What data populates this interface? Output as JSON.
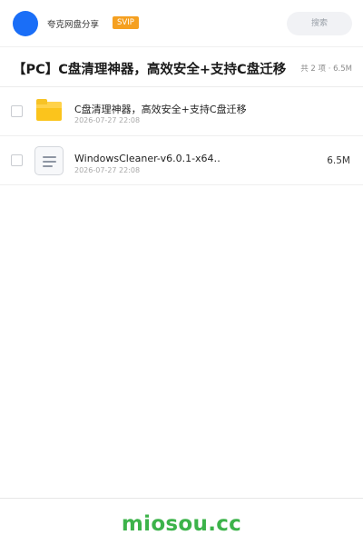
{
  "header": {
    "share_name": "夸克网盘分享",
    "badge": "SVIP",
    "search_placeholder": "搜索"
  },
  "title_bar": {
    "title": "【PC】C盘清理神器，高效安全+支持C盘迁移",
    "meta": "共 2 项 · 6.5M"
  },
  "files": [
    {
      "name": "C盘清理神器，高效安全+支持C盘迁移",
      "date": "2026-07-27 22:08",
      "size": "",
      "icon": "folder-icon"
    },
    {
      "name": "WindowsCleaner-v6.0.1-x64…",
      "date": "2026-07-27 22:08",
      "size": "6.5M",
      "icon": "file-icon"
    }
  ],
  "footer": {
    "brand": "miosou.cc"
  },
  "colors": {
    "avatar": "#1a6ef7",
    "badge": "#f5a020",
    "folder": "#fbc41c",
    "brand": "#3cb34a"
  }
}
